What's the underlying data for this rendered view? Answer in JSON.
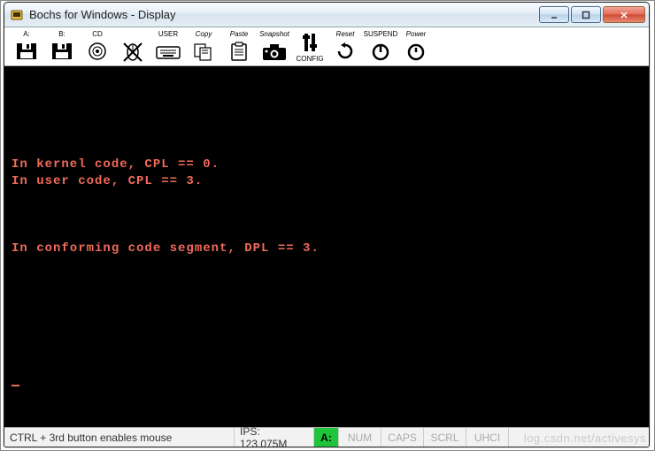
{
  "title": "Bochs for Windows - Display",
  "toolbar": [
    {
      "name": "drive-a",
      "label": "A:"
    },
    {
      "name": "drive-b",
      "label": "B:"
    },
    {
      "name": "drive-cd",
      "label": "CD"
    },
    {
      "name": "mouse-toggle",
      "label": ""
    },
    {
      "name": "user-button",
      "label": "USER"
    },
    {
      "name": "copy-button",
      "label": "Copy"
    },
    {
      "name": "paste-button",
      "label": "Paste"
    },
    {
      "name": "snapshot-button",
      "label": "Snapshot"
    },
    {
      "name": "config-button",
      "label": "CONFIG"
    },
    {
      "name": "reset-button",
      "label": "Reset"
    },
    {
      "name": "suspend-button",
      "label": "SUSPEND"
    },
    {
      "name": "power-button",
      "label": "Power"
    }
  ],
  "terminal_lines": [
    "",
    "",
    "",
    "",
    "In kernel code, CPL == 0.",
    "In user code, CPL == 3.",
    "",
    "",
    "",
    "In conforming code segment, DPL == 3.",
    "",
    "",
    "",
    "",
    "",
    "",
    "",
    ""
  ],
  "status": {
    "mouse_hint": "CTRL + 3rd button enables mouse",
    "ips": "IPS: 123.075M",
    "drive": "A:",
    "num": "NUM",
    "caps": "CAPS",
    "scrl": "SCRL",
    "uhci": "UHCI"
  },
  "watermark": "log.csdn.net/activesys"
}
